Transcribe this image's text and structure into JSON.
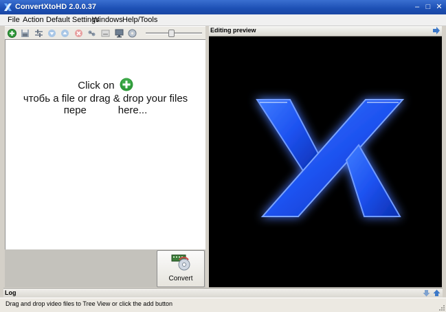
{
  "window": {
    "title": "ConvertXtoHD 2.0.0.37"
  },
  "menubar": {
    "items": [
      "File",
      "Action",
      "Default Settings",
      "Windows",
      "Help/Tools"
    ]
  },
  "toolbar": {
    "icons": [
      "add-file-icon",
      "save-icon",
      "settings-icon",
      "move-down-icon",
      "move-up-icon",
      "delete-icon",
      "chapters-icon",
      "subtitle-icon",
      "monitor-icon",
      "disc-icon"
    ],
    "zoom_slider_level": 0.45
  },
  "treeview": {
    "hint_line1": "Click on",
    "hint_line2": "чтобь a file or drag & drop your files",
    "hint_line3": "пере           here..."
  },
  "convert_button": {
    "label": "Convert"
  },
  "preview": {
    "title": "Editing preview",
    "logo_letter": "X"
  },
  "log": {
    "title": "Log"
  },
  "status": {
    "text": "Drag and drop video files to Tree View or click the add button"
  },
  "colors": {
    "title_bar": "#1c4fb4",
    "logo_blue": "#1d52f0",
    "preview_bg": "#000000",
    "add_green": "#2f9a3a"
  }
}
